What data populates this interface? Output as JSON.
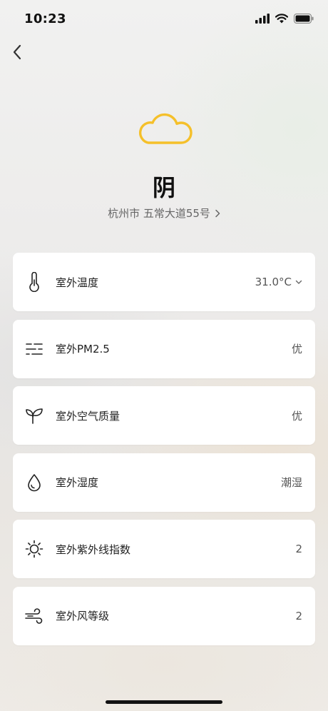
{
  "status_bar": {
    "time": "10:23"
  },
  "weather": {
    "condition": "阴",
    "location": "杭州市 五常大道55号",
    "icon": "cloud-icon",
    "icon_color": "#F5C02A"
  },
  "cards": [
    {
      "label": "室外温度",
      "value": "31.0°C",
      "icon": "thermometer-icon",
      "has_dropdown": true
    },
    {
      "label": "室外PM2.5",
      "value": "优",
      "icon": "pm-lines-icon"
    },
    {
      "label": "室外空气质量",
      "value": "优",
      "icon": "sprout-icon"
    },
    {
      "label": "室外湿度",
      "value": "潮湿",
      "icon": "water-drop-icon"
    },
    {
      "label": "室外紫外线指数",
      "value": "2",
      "icon": "sun-icon"
    },
    {
      "label": "室外风等级",
      "value": "2",
      "icon": "wind-icon"
    }
  ]
}
